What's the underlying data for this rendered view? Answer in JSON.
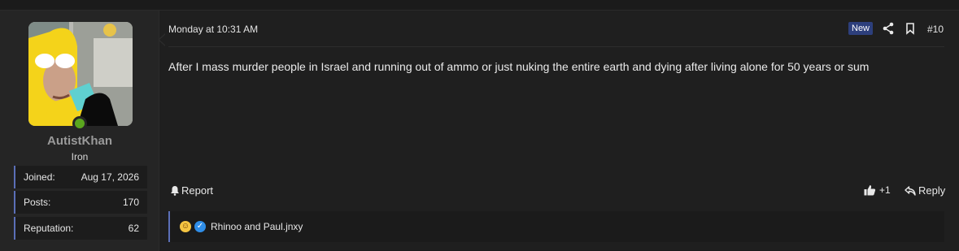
{
  "user": {
    "name": "AutistKhan",
    "title": "Iron",
    "stats": [
      {
        "label": "Joined:",
        "value": "Aug 17, 2026"
      },
      {
        "label": "Posts:",
        "value": "170"
      },
      {
        "label": "Reputation:",
        "value": "62"
      }
    ],
    "avatar_icon": "avatar-image"
  },
  "post": {
    "date": "Monday at 10:31 AM",
    "badge": "New",
    "number": "#10",
    "message": "After I mass murder people in Israel and running out of ammo or just nuking the entire earth and dying after living alone for 50 years or sum",
    "actions": {
      "report": "Report",
      "react_count": "+1",
      "reply": "Reply"
    },
    "reactions": {
      "text": "Rhinoo and Paul.jnxy",
      "icons": [
        "laughing-face-icon",
        "thumbs-up-icon"
      ]
    }
  },
  "colors": {
    "accent": "#5b6fb7",
    "badge_bg": "#2d3f7c",
    "online": "#5aa61e"
  }
}
